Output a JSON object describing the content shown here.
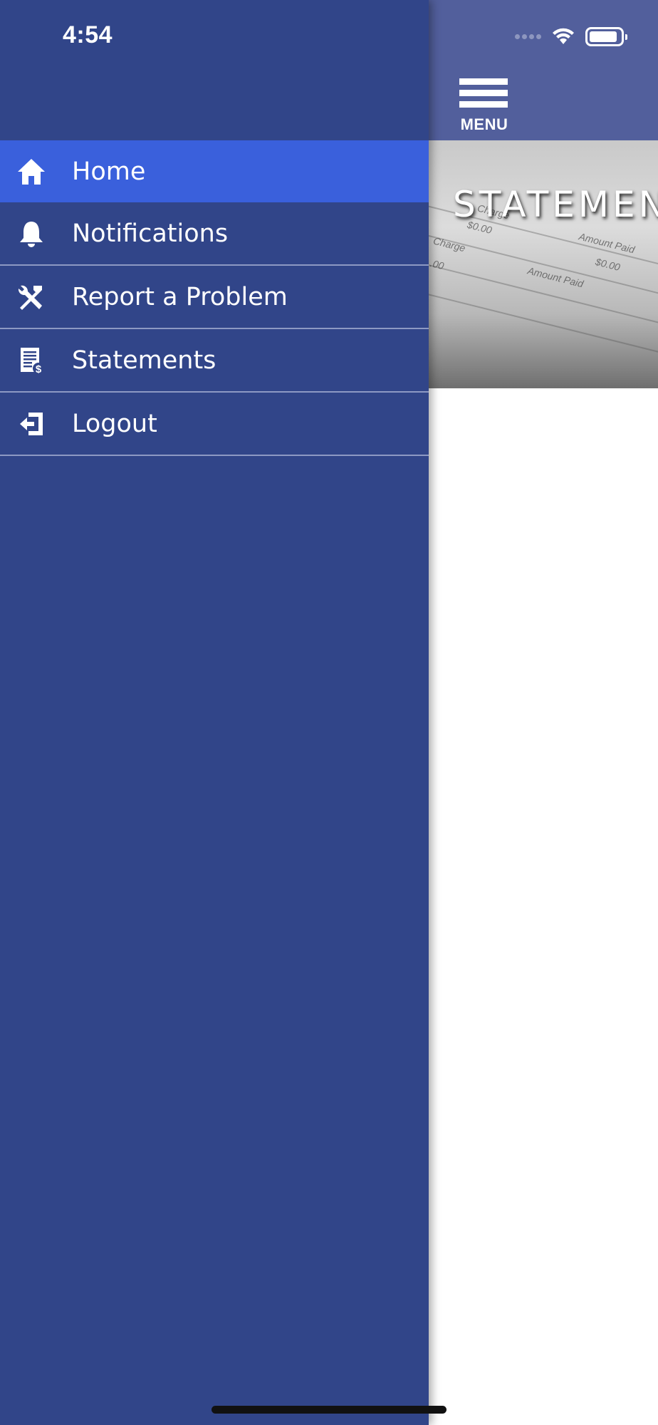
{
  "status_bar": {
    "time": "4:54",
    "battery_level": 0.8
  },
  "main": {
    "menu_button_label": "MENU",
    "hero_title": "STATEMEN",
    "hero_image_words": [
      "Charge",
      "$0.00",
      "Amount Paid",
      "$0.00",
      "Charge",
      ".00",
      "Amount Paid"
    ]
  },
  "drawer": {
    "items": [
      {
        "label": "Home",
        "icon": "home-icon",
        "active": true
      },
      {
        "label": "Notifications",
        "icon": "bell-icon",
        "active": false
      },
      {
        "label": "Report a Problem",
        "icon": "tools-icon",
        "active": false
      },
      {
        "label": "Statements",
        "icon": "statement-icon",
        "active": false
      },
      {
        "label": "Logout",
        "icon": "logout-icon",
        "active": false
      }
    ]
  },
  "colors": {
    "drawer_bg": "#314589",
    "active_item_bg": "#3a60dc",
    "header_bg": "#525f9c",
    "divider": "#8d99c3"
  }
}
